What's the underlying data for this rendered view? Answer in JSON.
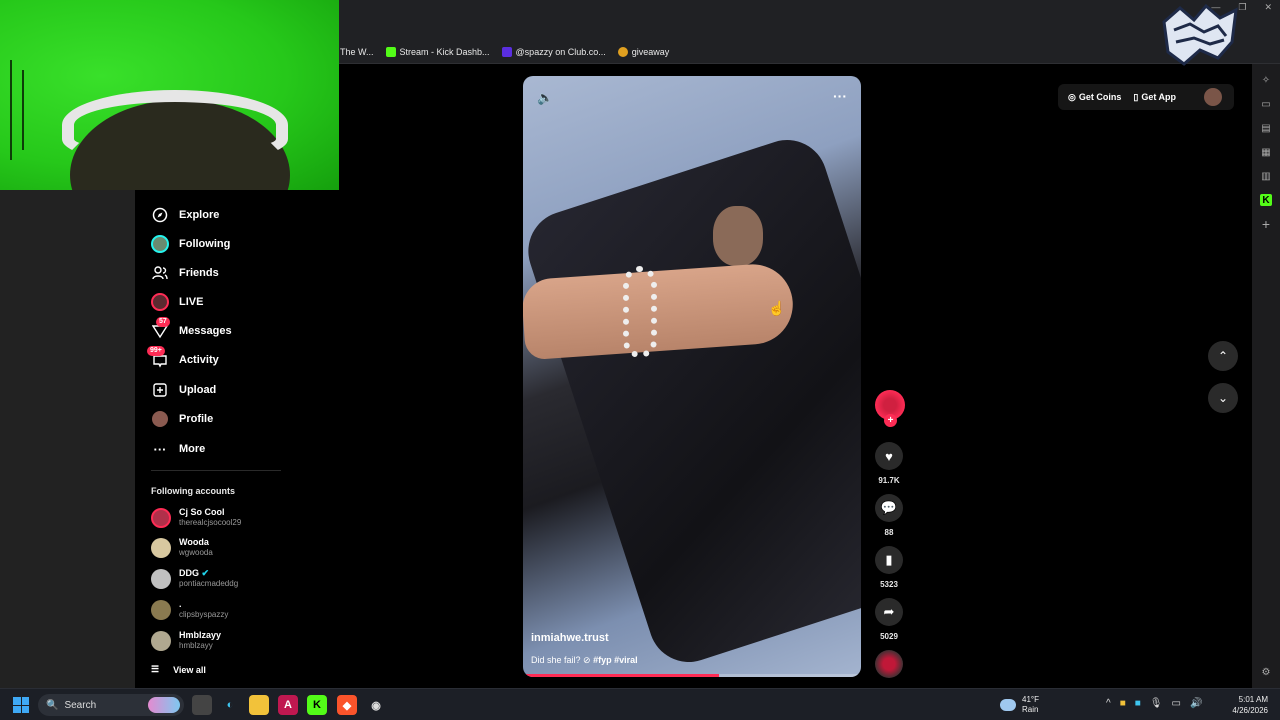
{
  "bookmarks": [
    {
      "label": "The W...",
      "color": "#ffffff"
    },
    {
      "label": "Stream - Kick Dashb...",
      "color": "#53fc18"
    },
    {
      "label": "@spazzy on Club.co...",
      "color": "#5a2ee0"
    },
    {
      "label": "giveaway",
      "color": "#e0a020"
    }
  ],
  "sidebar": {
    "items": [
      {
        "label": "Explore",
        "icon": "compass-icon",
        "glyph": "◎"
      },
      {
        "label": "Following",
        "icon": "following-avatar-icon",
        "glyph": "●"
      },
      {
        "label": "Friends",
        "icon": "friends-icon",
        "glyph": "👥"
      },
      {
        "label": "LIVE",
        "icon": "live-avatar-icon",
        "glyph": "●"
      },
      {
        "label": "Messages",
        "icon": "messages-icon",
        "glyph": "▽",
        "badge": "57"
      },
      {
        "label": "Activity",
        "icon": "activity-icon",
        "glyph": "▭",
        "badge": "99+"
      },
      {
        "label": "Upload",
        "icon": "upload-icon",
        "glyph": "⊞"
      },
      {
        "label": "Profile",
        "icon": "profile-avatar-icon",
        "glyph": "●"
      },
      {
        "label": "More",
        "icon": "more-icon",
        "glyph": "···"
      }
    ],
    "following_title": "Following accounts",
    "accounts": [
      {
        "name": "Cj So Cool",
        "handle": "therealcjsocool29",
        "color": "#b0304a"
      },
      {
        "name": "Wooda",
        "handle": "wgwooda",
        "color": "#d8c8a0"
      },
      {
        "name": "DDG",
        "handle": "pontiacmadeddg",
        "color": "#c0c0c0"
      },
      {
        "name": ".",
        "handle": "clipsbyspazzy",
        "color": "#8a7a50"
      },
      {
        "name": "Hmblzayy",
        "handle": "hmblzayy",
        "color": "#b0a890"
      }
    ],
    "view_all": "View all"
  },
  "video": {
    "username": "inmiahwe.trust",
    "caption": "Did she fail?",
    "hashtags": "#fyp #viral",
    "progress": 0.58
  },
  "actions": {
    "likes": "91.7K",
    "comments": "88",
    "saves": "5323",
    "shares": "5029"
  },
  "topbar": {
    "get_coins": "Get Coins",
    "get_app": "Get App"
  },
  "taskbar": {
    "search_placeholder": "Search",
    "temperature": "41°F",
    "weather": "Rain",
    "time": "5:01 AM",
    "date": "4/26/2026"
  },
  "colors": {
    "accent": "#fe2c55",
    "kick_green": "#53fc18"
  }
}
